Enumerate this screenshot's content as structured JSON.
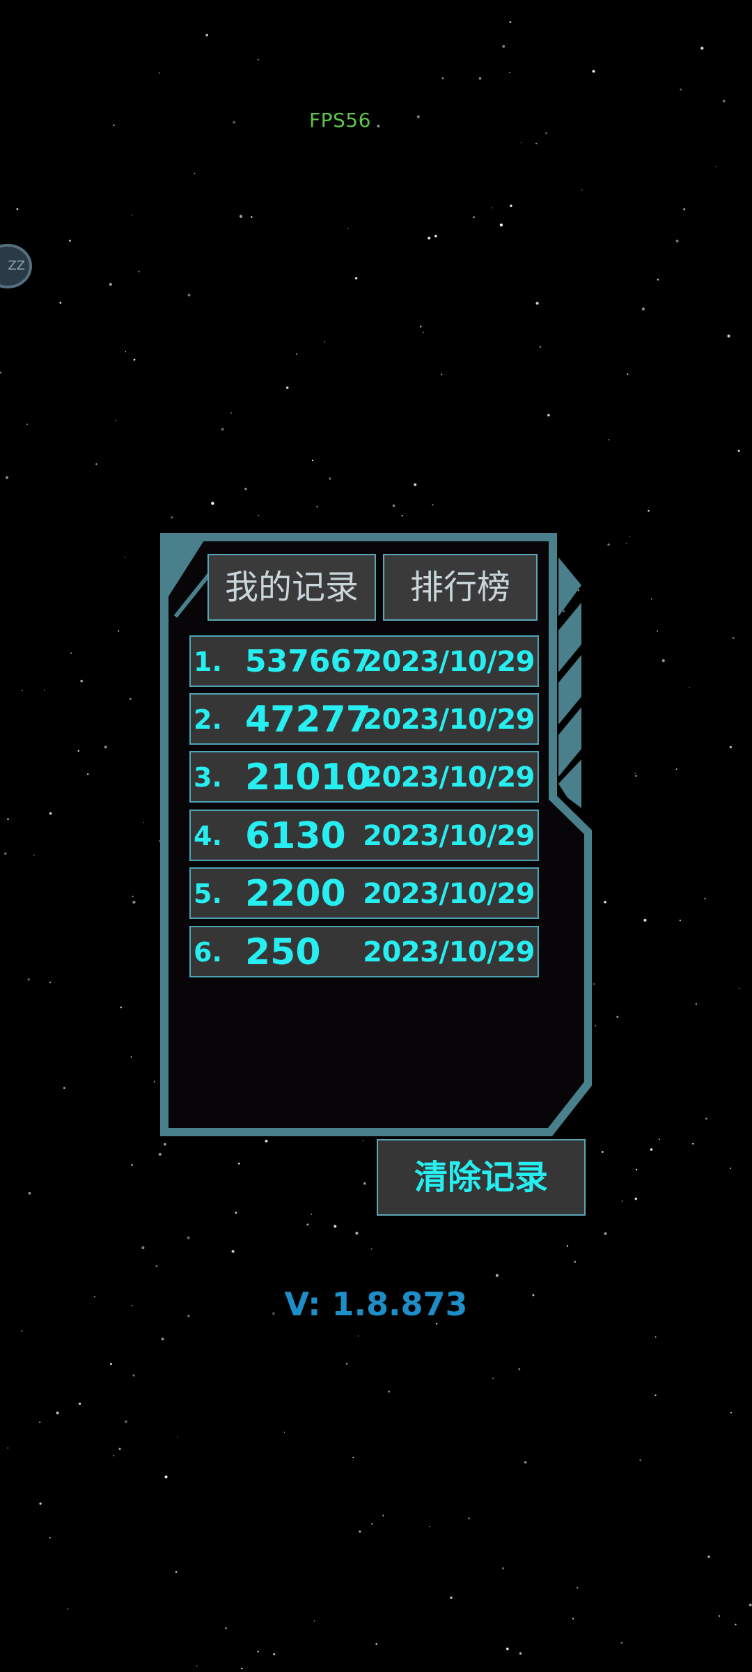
{
  "hud": {
    "fps_text": "FPS56",
    "bubble_text": "ZZ"
  },
  "tabs": {
    "my_records": "我的记录",
    "leaderboard": "排行榜",
    "active": "my_records"
  },
  "records": [
    {
      "rank": "1.",
      "score": "537667",
      "date": "2023/10/29"
    },
    {
      "rank": "2.",
      "score": "47277",
      "date": "2023/10/29"
    },
    {
      "rank": "3.",
      "score": "21010",
      "date": "2023/10/29"
    },
    {
      "rank": "4.",
      "score": "6130",
      "date": "2023/10/29"
    },
    {
      "rank": "5.",
      "score": "2200",
      "date": "2023/10/29"
    },
    {
      "rank": "6.",
      "score": "250",
      "date": "2023/10/29"
    }
  ],
  "actions": {
    "clear_records": "清除记录"
  },
  "footer": {
    "version": "V: 1.8.873"
  },
  "colors": {
    "frame": "#4a7f8c",
    "accent_text": "#27eef0",
    "version_text": "#1d8ec7",
    "fps_text": "#5fc44a"
  }
}
